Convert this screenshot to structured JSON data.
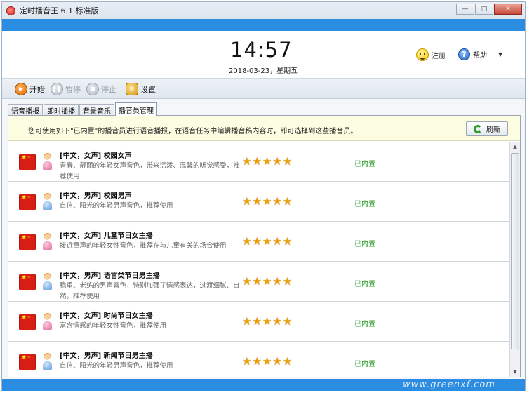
{
  "window": {
    "title": "定时播音王 6.1 标准版",
    "controls": {
      "minimize": "—",
      "maximize": "□",
      "close": "✕"
    }
  },
  "header": {
    "time": "14:57",
    "date": "2018-03-23，星期五",
    "register_label": "注册",
    "help_label": "帮助"
  },
  "toolbar": {
    "start_label": "开始",
    "pause_label": "暂停",
    "stop_label": "停止",
    "settings_label": "设置"
  },
  "tabs": [
    {
      "label": "语音播报"
    },
    {
      "label": "即时插播"
    },
    {
      "label": "背景音乐"
    },
    {
      "label": "播音员管理",
      "active": true
    }
  ],
  "notice": {
    "text": "您可使用如下\"已内置\"的播音员进行语音播报，在语音任务中编辑播音稿内容时，即可选择到这些播音员。",
    "refresh_label": "刷新"
  },
  "announcers": [
    {
      "name": "[中文，女声] 校园女声",
      "description": "青春、靓丽的年轻女声音色，带来活泼、温馨的听觉感受，推荐使用",
      "rating": 5,
      "status": "已内置",
      "gender": "female"
    },
    {
      "name": "[中文，男声] 校园男声",
      "description": "自信、阳光的年轻男声音色，推荐使用",
      "rating": 5,
      "status": "已内置",
      "gender": "male"
    },
    {
      "name": "[中文，女声] 儿童节目女主播",
      "description": "接近童声的年轻女性音色，推荐在与儿童有关的场合使用",
      "rating": 5,
      "status": "已内置",
      "gender": "female"
    },
    {
      "name": "[中文，男声] 语言类节目男主播",
      "description": "稳重、老练的男声音色，特别加强了情感表达，过渡细腻、自然，推荐使用",
      "rating": 5,
      "status": "已内置",
      "gender": "male"
    },
    {
      "name": "[中文，女声] 时尚节目女主播",
      "description": "富含情感的年轻女性音色，推荐使用",
      "rating": 5,
      "status": "已内置",
      "gender": "female"
    },
    {
      "name": "[中文，男声] 新闻节目男主播",
      "description": "自信、阳光的年轻男声音色，推荐使用",
      "rating": 5,
      "status": "已内置",
      "gender": "male"
    }
  ],
  "watermark": "www.greenxf.com"
}
